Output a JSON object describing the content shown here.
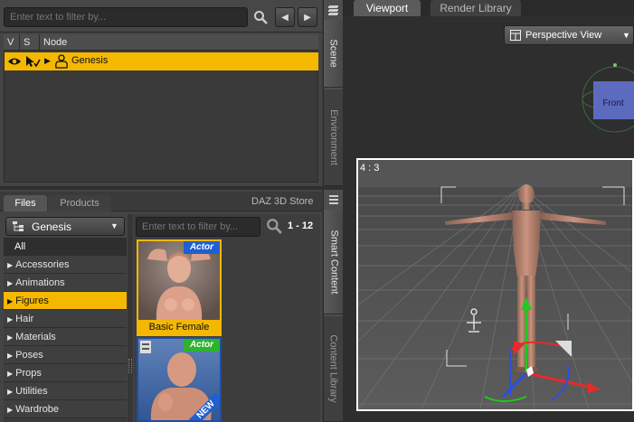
{
  "scene": {
    "filter_placeholder": "Enter text to filter by...",
    "columns": [
      "V",
      "S",
      "Node"
    ],
    "rows": [
      {
        "label": "Genesis",
        "selected": true
      }
    ]
  },
  "side_tabs_top": [
    "Scene",
    "Environment"
  ],
  "side_tabs_bottom": [
    "Smart Content",
    "Content Library"
  ],
  "content": {
    "tabs": [
      "Files",
      "Products"
    ],
    "store_label": "DAZ 3D Store",
    "figure_select": "Genesis",
    "filter_placeholder": "Enter text to filter by...",
    "page_count": "1 - 12",
    "categories": [
      {
        "label": "All",
        "selected": false,
        "expandable": false
      },
      {
        "label": "Accessories",
        "expandable": true
      },
      {
        "label": "Animations",
        "expandable": true
      },
      {
        "label": "Figures",
        "expandable": true,
        "selected": true
      },
      {
        "label": "Hair",
        "expandable": true
      },
      {
        "label": "Materials",
        "expandable": true
      },
      {
        "label": "Poses",
        "expandable": true
      },
      {
        "label": "Props",
        "expandable": true
      },
      {
        "label": "Utilities",
        "expandable": true
      },
      {
        "label": "Wardrobe",
        "expandable": true
      }
    ],
    "items": [
      {
        "badge": "Actor",
        "caption": "Basic Female"
      },
      {
        "badge": "Actor",
        "ribbon": "NEW"
      }
    ]
  },
  "viewport": {
    "tabs": [
      "Viewport",
      "Render Library"
    ],
    "view_mode": "Perspective View",
    "aspect": "4 : 3",
    "cube_face": "Front"
  },
  "colors": {
    "accent": "#f4b800",
    "badge_blue": "#1f5fd1",
    "badge_green": "#2db32d"
  }
}
